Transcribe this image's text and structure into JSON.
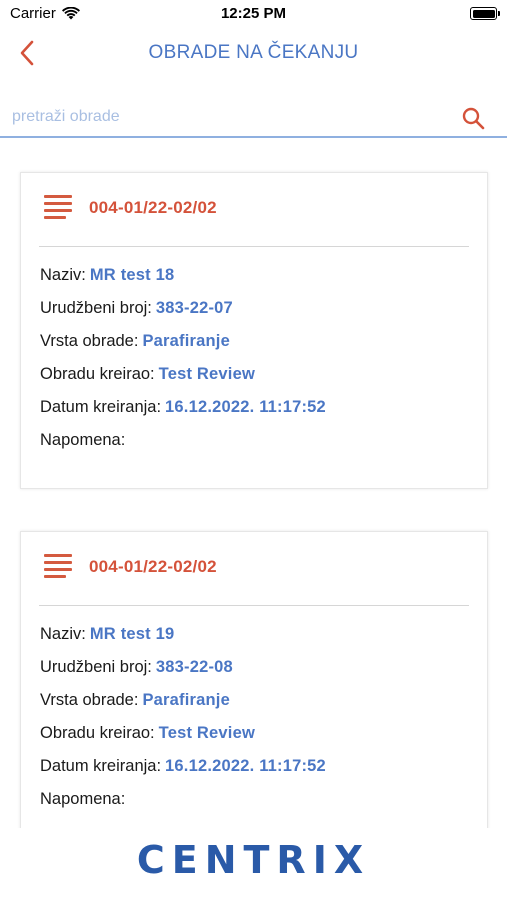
{
  "status_bar": {
    "carrier": "Carrier",
    "time": "12:25 PM"
  },
  "nav": {
    "title": "OBRADE NA ČEKANJU",
    "back_icon": "chevron-left-icon"
  },
  "search": {
    "placeholder": "pretraži obrade",
    "value": "",
    "icon": "search-icon"
  },
  "cards": [
    {
      "number": "004-01/22-02/02",
      "icon": "document-lines-icon",
      "fields": [
        {
          "label": "Naziv:",
          "value": "MR test 18"
        },
        {
          "label": "Urudžbeni broj:",
          "value": "383-22-07"
        },
        {
          "label": "Vrsta obrade:",
          "value": "Parafiranje"
        },
        {
          "label": "Obradu kreirao:",
          "value": "Test Review"
        },
        {
          "label": "Datum kreiranja:",
          "value": "16.12.2022. 11:17:52"
        },
        {
          "label": "Napomena:",
          "value": ""
        }
      ]
    },
    {
      "number": "004-01/22-02/02",
      "icon": "document-lines-icon",
      "fields": [
        {
          "label": "Naziv:",
          "value": "MR test 19"
        },
        {
          "label": "Urudžbeni broj:",
          "value": "383-22-08"
        },
        {
          "label": "Vrsta obrade:",
          "value": "Parafiranje"
        },
        {
          "label": "Obradu kreirao:",
          "value": "Test Review"
        },
        {
          "label": "Datum kreiranja:",
          "value": "16.12.2022. 11:17:52"
        },
        {
          "label": "Napomena:",
          "value": ""
        }
      ]
    }
  ],
  "footer": {
    "brand": "CENTRIX"
  },
  "colors": {
    "accent_blue": "#4a76c4",
    "accent_red": "#d4523a",
    "brand_blue": "#2a5aa8"
  }
}
